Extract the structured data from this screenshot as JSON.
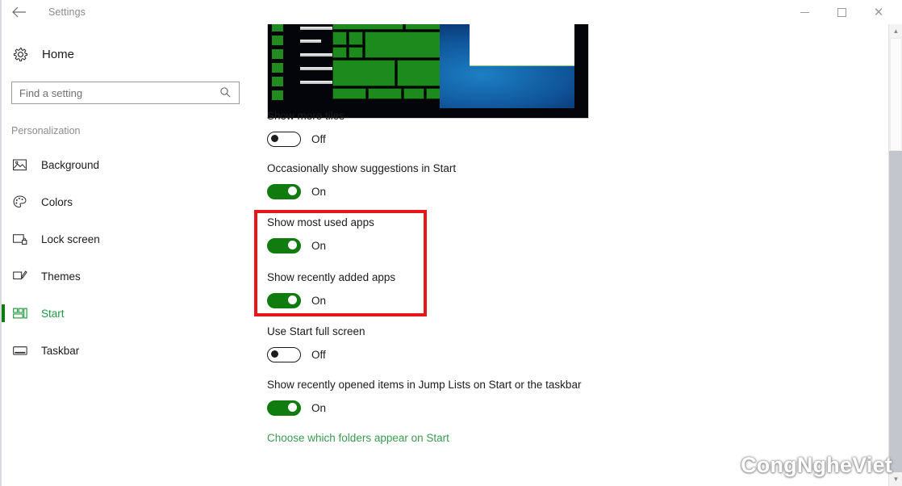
{
  "window": {
    "title": "Settings",
    "back_icon": "back-arrow-icon",
    "minimize_label": "Minimize",
    "maximize_label": "Maximize",
    "close_label": "Close"
  },
  "sidebar": {
    "home": {
      "label": "Home",
      "icon": "gear-icon"
    },
    "search": {
      "placeholder": "Find a setting",
      "value": "",
      "icon": "search-icon"
    },
    "section_label": "Personalization",
    "items": [
      {
        "label": "Background",
        "icon": "picture-icon",
        "active": false
      },
      {
        "label": "Colors",
        "icon": "palette-icon",
        "active": false
      },
      {
        "label": "Lock screen",
        "icon": "lock-screen-icon",
        "active": false
      },
      {
        "label": "Themes",
        "icon": "paintbrush-icon",
        "active": false
      },
      {
        "label": "Start",
        "icon": "start-tiles-icon",
        "active": true
      },
      {
        "label": "Taskbar",
        "icon": "taskbar-icon",
        "active": false
      }
    ]
  },
  "main": {
    "preview_alt": "Start menu preview",
    "settings": [
      {
        "label": "Show more tiles",
        "state": "Off",
        "on": false
      },
      {
        "label": "Occasionally show suggestions in Start",
        "state": "On",
        "on": true
      },
      {
        "label": "Show most used apps",
        "state": "On",
        "on": true
      },
      {
        "label": "Show recently added apps",
        "state": "On",
        "on": true
      },
      {
        "label": "Use Start full screen",
        "state": "Off",
        "on": false
      },
      {
        "label": "Show recently opened items in Jump Lists on Start or the taskbar",
        "state": "On",
        "on": true
      }
    ],
    "link": "Choose which folders appear on Start"
  },
  "annotation": {
    "color": "#e8151b",
    "highlights": [
      "Show most used apps",
      "Show recently added apps"
    ]
  },
  "watermark": "CongNgheViet",
  "colors": {
    "accent_green": "#107c10",
    "link_green": "#3a9b4e",
    "annotation_red": "#e8151b"
  }
}
